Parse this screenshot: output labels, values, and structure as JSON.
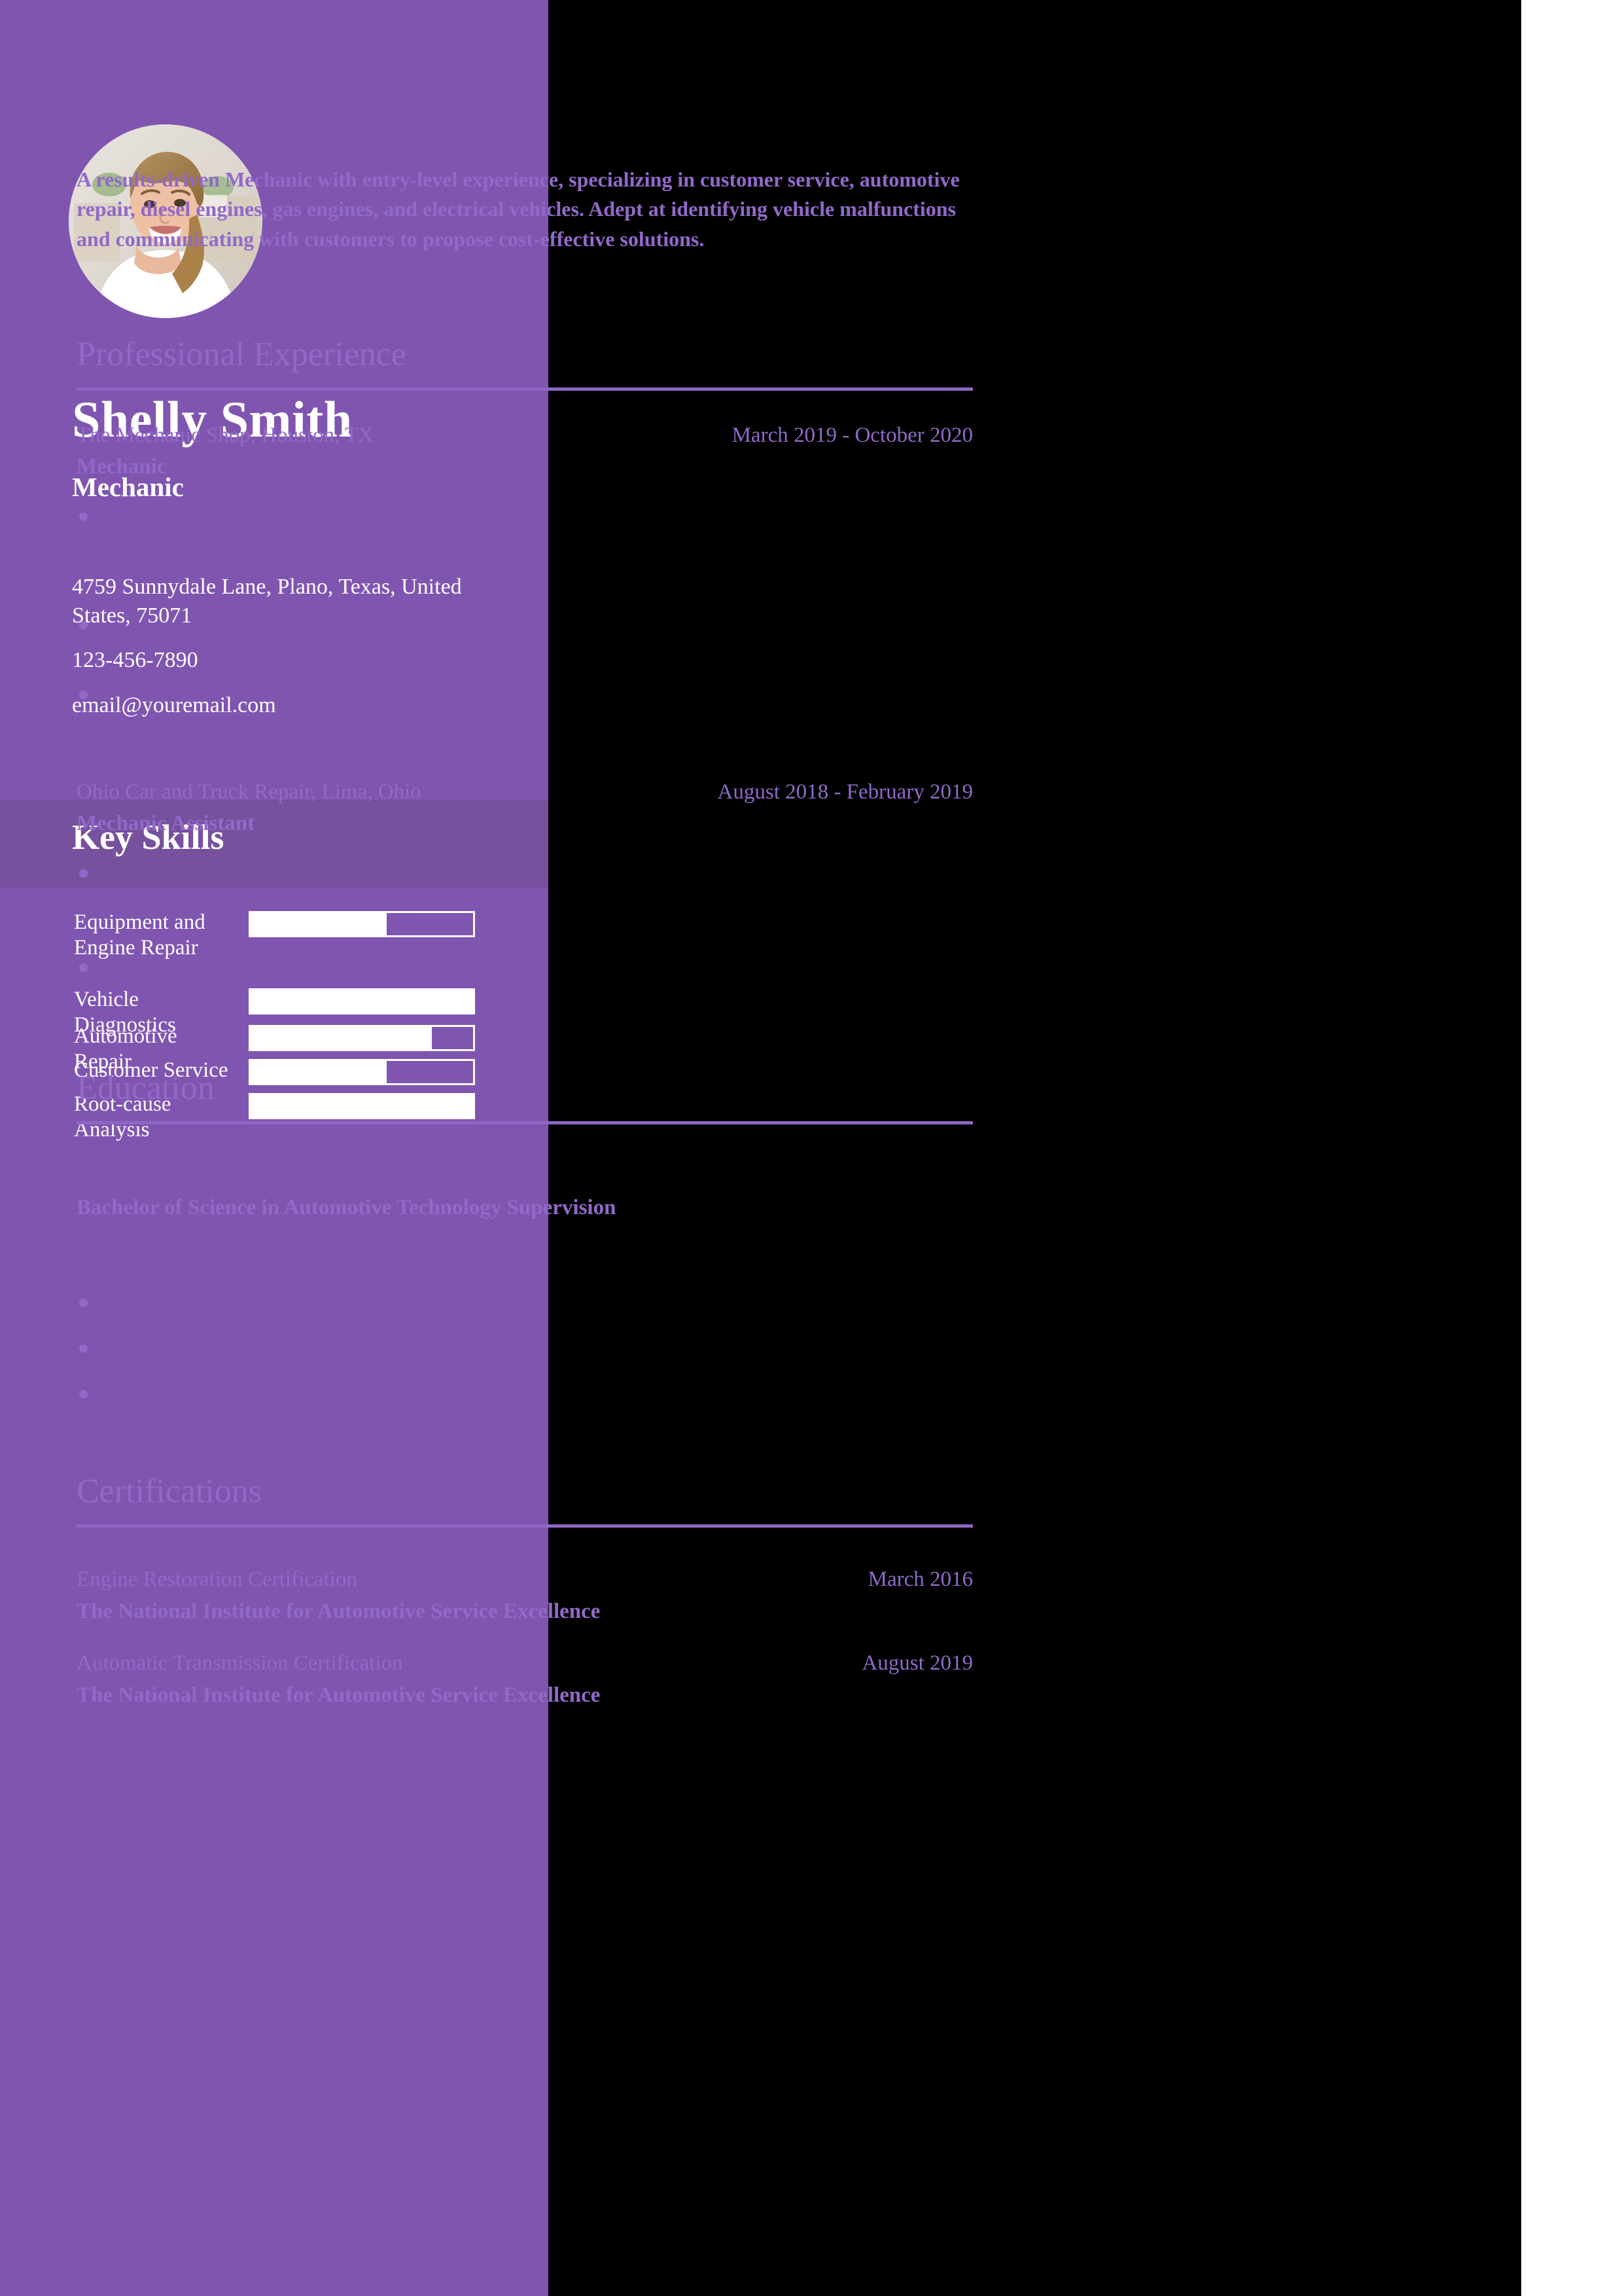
{
  "theme": {
    "sidebar_bg": "#8055b0",
    "skills_band_bg": "#77509e",
    "main_bg": "#000000",
    "accent_text": "#9169c9",
    "rule_color": "#8e66c6",
    "sidebar_text": "#ffffff",
    "page_bg": "#ffffff"
  },
  "profile": {
    "avatar_icon": "profile-photo",
    "name": "Shelly Smith",
    "role": "Mechanic",
    "contact": {
      "address": "4759 Sunnydale Lane, Plano, Texas, United States, 75071",
      "phone": "123-456-7890",
      "email": "email@youremail.com"
    }
  },
  "skills": {
    "title": "Key Skills",
    "items": [
      {
        "label": "Equipment and Engine Repair",
        "level": 60
      },
      {
        "label": "Vehicle Diagnostics",
        "level": 100
      },
      {
        "label": "Automotive Repair",
        "level": 80
      },
      {
        "label": "Customer Service",
        "level": 60
      },
      {
        "label": "Root-cause Analysis",
        "level": 100
      }
    ]
  },
  "summary": {
    "text": "A results-driven Mechanic with entry-level experience, specializing in customer service, automotive repair, diesel engines, gas engines, and electrical vehicles. Adept at identifying vehicle malfunctions and communicating with customers to propose cost-effective solutions."
  },
  "experience": {
    "heading": "Professional Experience",
    "entries": [
      {
        "organization": "The Mechanic Shop, Houston, TX",
        "date": "March 2019 - October 2020",
        "title": "Mechanic",
        "bullets": [
          "",
          "",
          ""
        ]
      },
      {
        "organization": "Ohio Car and Truck Repair, Lima, Ohio",
        "date": "August 2018 - February 2019",
        "title": "Mechanic Assistant",
        "bullets": [
          "",
          ""
        ]
      }
    ]
  },
  "education": {
    "heading": "Education",
    "entries": [
      {
        "degree": "Bachelor of Science in Automotive Technology Supervision",
        "bullets": [
          "",
          "",
          ""
        ]
      }
    ]
  },
  "certifications": {
    "heading": "Certifications",
    "entries": [
      {
        "name": "Engine Restoration Certification",
        "date": "March 2016",
        "organization": "The National Institute for Automotive Service Excellence"
      },
      {
        "name": "Automatic Transmission Certification",
        "date": "August 2019",
        "organization": "The National Institute for Automotive Service Excellence"
      }
    ]
  }
}
